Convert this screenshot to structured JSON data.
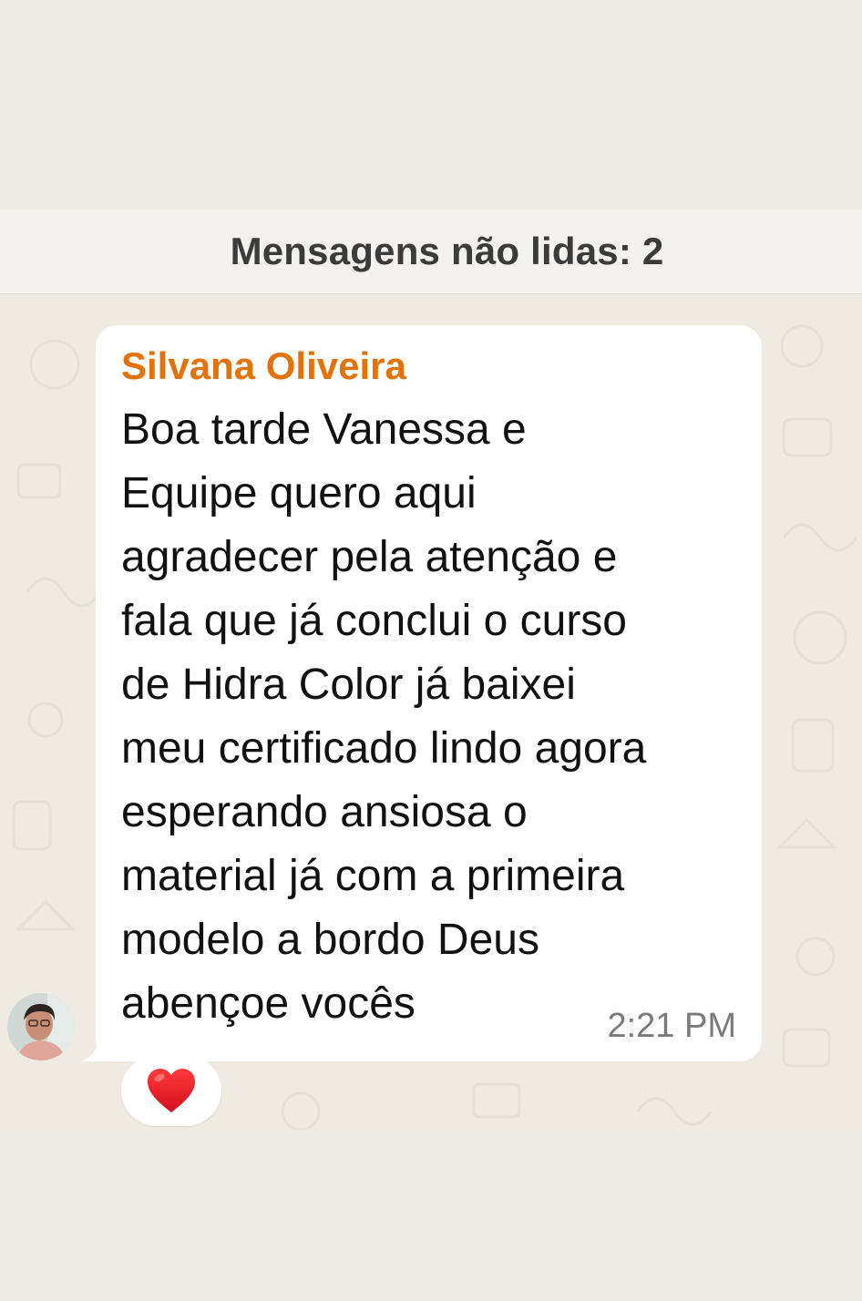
{
  "chat": {
    "unread_label": "Mensagens não lidas: 2"
  },
  "message": {
    "sender": "Silvana Oliveira",
    "sender_color": "#e2720a",
    "lines": [
      "Boa tarde Vanessa e",
      "Equipe quero aqui",
      "agradecer pela atenção e",
      "fala que já conclui o curso",
      "de Hidra Color já baixei",
      "meu certificado lindo agora",
      "esperando ansiosa o",
      "material já com a primeira",
      "modelo a bordo Deus",
      "abençoe vocês"
    ],
    "time": "2:21 PM",
    "avatar_icon": "user-photo",
    "reaction": "❤️",
    "reaction_icon": "red-heart-icon"
  }
}
